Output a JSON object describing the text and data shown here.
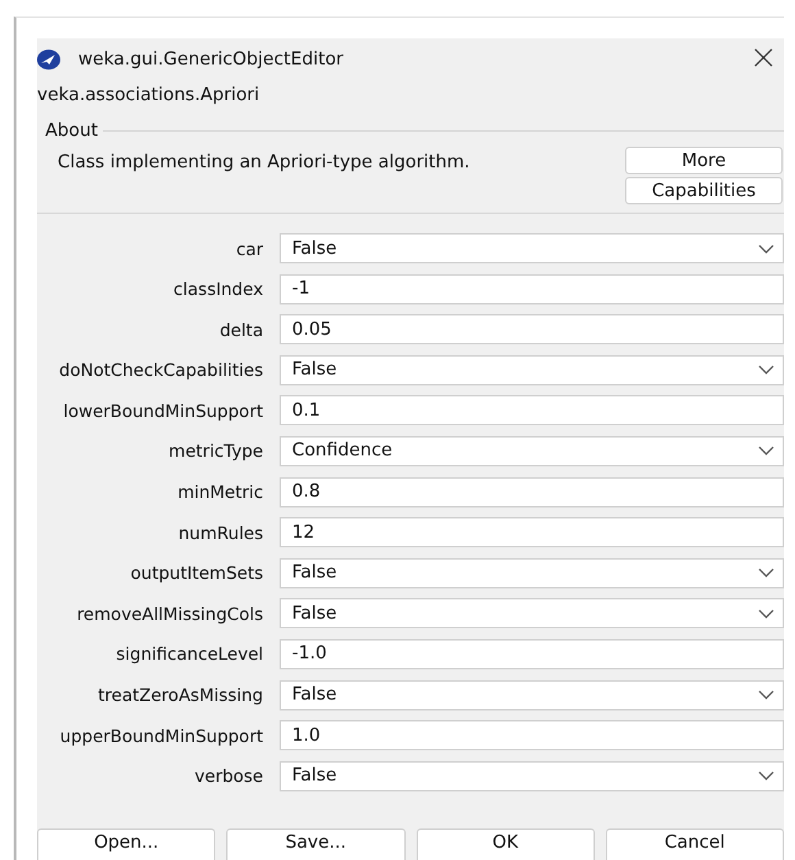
{
  "window": {
    "title": "weka.gui.GenericObjectEditor"
  },
  "object_name": "veka.associations.Apriori",
  "about": {
    "legend": "About",
    "description": "Class implementing an Apriori-type algorithm.",
    "buttons": [
      "More",
      "Capabilities"
    ]
  },
  "properties": [
    {
      "label": "car",
      "kind": "dropdown",
      "value": "False"
    },
    {
      "label": "classIndex",
      "kind": "text",
      "value": "-1"
    },
    {
      "label": "delta",
      "kind": "text",
      "value": "0.05"
    },
    {
      "label": "doNotCheckCapabilities",
      "kind": "dropdown",
      "value": "False"
    },
    {
      "label": "lowerBoundMinSupport",
      "kind": "text",
      "value": "0.1"
    },
    {
      "label": "metricType",
      "kind": "dropdown",
      "value": "Confidence"
    },
    {
      "label": "minMetric",
      "kind": "text",
      "value": "0.8"
    },
    {
      "label": "numRules",
      "kind": "text",
      "value": "12"
    },
    {
      "label": "outputItemSets",
      "kind": "dropdown",
      "value": "False"
    },
    {
      "label": "removeAllMissingCols",
      "kind": "dropdown",
      "value": "False"
    },
    {
      "label": "significanceLevel",
      "kind": "text",
      "value": "-1.0"
    },
    {
      "label": "treatZeroAsMissing",
      "kind": "dropdown",
      "value": "False"
    },
    {
      "label": "upperBoundMinSupport",
      "kind": "text",
      "value": "1.0"
    },
    {
      "label": "verbose",
      "kind": "dropdown",
      "value": "False"
    }
  ],
  "buttons": [
    "Open...",
    "Save...",
    "OK",
    "Cancel"
  ]
}
